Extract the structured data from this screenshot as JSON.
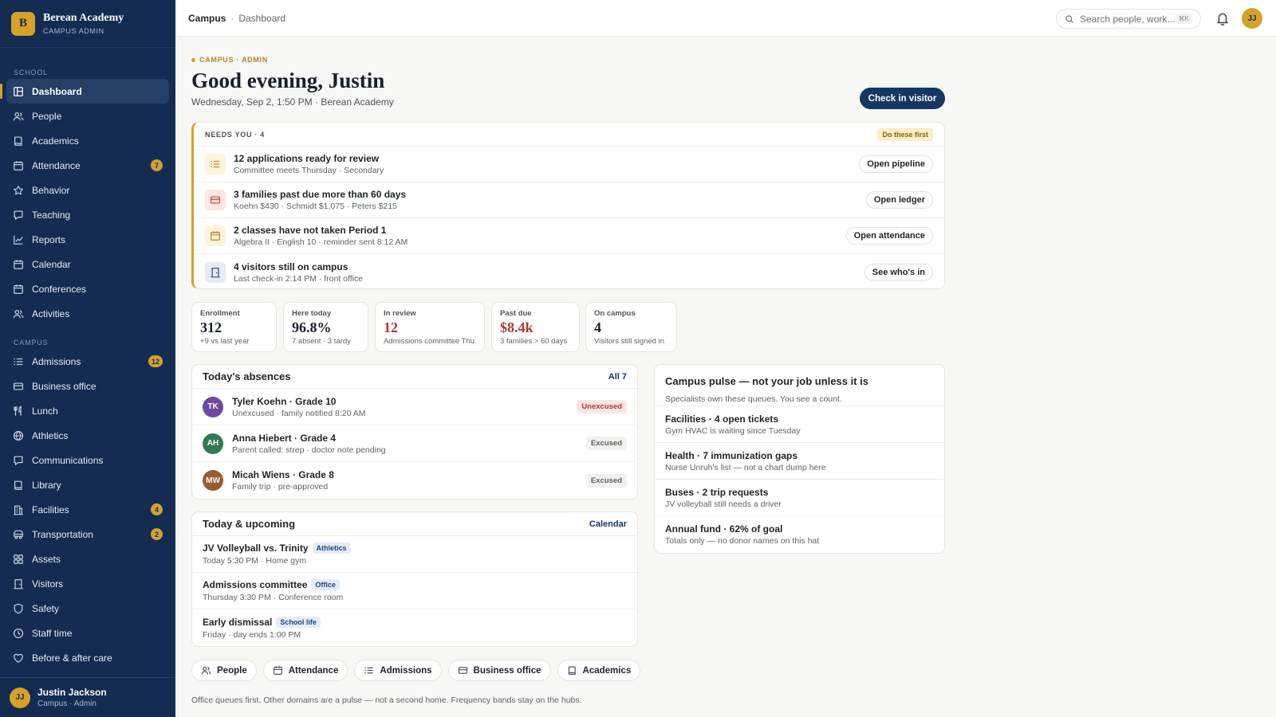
{
  "brand": {
    "initial": "B",
    "name": "Berean Academy",
    "role": "CAMPUS ADMIN"
  },
  "sidebar": {
    "school_label": "SCHOOL",
    "campus_label": "CAMPUS",
    "school_items": [
      {
        "label": "Dashboard",
        "icon": "dashboard-icon",
        "active": true
      },
      {
        "label": "People",
        "icon": "people-icon"
      },
      {
        "label": "Academics",
        "icon": "book-icon"
      },
      {
        "label": "Attendance",
        "icon": "calendar-icon",
        "badge": "7"
      },
      {
        "label": "Behavior",
        "icon": "star-icon"
      },
      {
        "label": "Teaching",
        "icon": "chat-icon"
      },
      {
        "label": "Reports",
        "icon": "chart-icon"
      },
      {
        "label": "Calendar",
        "icon": "calendar-icon"
      },
      {
        "label": "Conferences",
        "icon": "calendar-icon"
      },
      {
        "label": "Activities",
        "icon": "people-icon"
      }
    ],
    "campus_items": [
      {
        "label": "Admissions",
        "icon": "list-icon",
        "badge": "12"
      },
      {
        "label": "Business office",
        "icon": "card-icon"
      },
      {
        "label": "Lunch",
        "icon": "utensils-icon"
      },
      {
        "label": "Athletics",
        "icon": "ball-icon"
      },
      {
        "label": "Communications",
        "icon": "chat-icon"
      },
      {
        "label": "Library",
        "icon": "book-icon"
      },
      {
        "label": "Facilities",
        "icon": "building-icon",
        "badge": "4"
      },
      {
        "label": "Transportation",
        "icon": "bus-icon",
        "badge": "2"
      },
      {
        "label": "Assets",
        "icon": "grid-icon"
      },
      {
        "label": "Visitors",
        "icon": "door-icon"
      },
      {
        "label": "Safety",
        "icon": "shield-icon"
      },
      {
        "label": "Staff time",
        "icon": "clock-icon"
      },
      {
        "label": "Before & after care",
        "icon": "heart-icon"
      }
    ],
    "user": {
      "initials": "JJ",
      "name": "Justin Jackson",
      "role": "Campus · Admin"
    }
  },
  "topbar": {
    "crumb_root": "Campus",
    "crumb_sep": "·",
    "crumb_current": "Dashboard",
    "search_placeholder": "Search people, work...",
    "search_shortcut": "⌘K",
    "user_initials": "JJ"
  },
  "header": {
    "eyebrow": "CAMPUS · ADMIN",
    "greeting": "Good evening, Justin",
    "dateline": "Wednesday, Sep 2, 1:50 PM · Berean Academy",
    "primary_action": "Check in visitor"
  },
  "needs": {
    "title": "NEEDS YOU · 4",
    "pill": "Do these first",
    "items": [
      {
        "title": "12 applications ready for review",
        "sub": "Committee meets Thursday · Secondary",
        "action": "Open pipeline",
        "icon": "list-icon",
        "bg": "#fcf3dc",
        "fg": "#b4852a"
      },
      {
        "title": "3 families past due more than 60 days",
        "sub": "Koehn $430 · Schmidt $1,075 · Peters $215",
        "action": "Open ledger",
        "icon": "card-icon",
        "bg": "#fbe6e3",
        "fg": "#c0463a"
      },
      {
        "title": "2 classes have not taken Period 1",
        "sub": "Algebra II · English 10 · reminder sent 8:12 AM",
        "action": "Open attendance",
        "icon": "calendar-icon",
        "bg": "#fcf3dc",
        "fg": "#b4852a"
      },
      {
        "title": "4 visitors still on campus",
        "sub": "Last check-in 2:14 PM · front office",
        "action": "See who's in",
        "icon": "door-icon",
        "bg": "#e6ecf5",
        "fg": "#2c4b78"
      }
    ]
  },
  "stats": [
    {
      "label": "Enrollment",
      "value": "312",
      "sub": "+9 vs last year",
      "color": "#1a1f2b"
    },
    {
      "label": "Here today",
      "value": "96.8%",
      "sub": "7 absent · 3 tardy",
      "color": "#1a1f2b"
    },
    {
      "label": "In review",
      "value": "12",
      "sub": "Admissions committee Thu",
      "color": "#b3362b"
    },
    {
      "label": "Past due",
      "value": "$8.4k",
      "sub": "3 families > 60 days",
      "color": "#b3362b"
    },
    {
      "label": "On campus",
      "value": "4",
      "sub": "Visitors still signed in",
      "color": "#1a1f2b"
    }
  ],
  "absences": {
    "title": "Today's absences",
    "link": "All 7",
    "items": [
      {
        "initials": "TK",
        "color": "#6c4a9e",
        "name": "Tyler Koehn · Grade 10",
        "sub": "Unexcused · family notified 8:20 AM",
        "status": "Unexcused",
        "kind": "unexcused"
      },
      {
        "initials": "AH",
        "color": "#2f7a55",
        "name": "Anna Hiebert · Grade 4",
        "sub": "Parent called: strep · doctor note pending",
        "status": "Excused",
        "kind": "excused"
      },
      {
        "initials": "MW",
        "color": "#9a5b2e",
        "name": "Micah Wiens · Grade 8",
        "sub": "Family trip · pre-approved",
        "status": "Excused",
        "kind": "excused"
      }
    ]
  },
  "upcoming": {
    "title": "Today & upcoming",
    "link": "Calendar",
    "items": [
      {
        "title": "JV Volleyball vs. Trinity",
        "tag": "Athletics",
        "sub": "Today 5:30 PM · Home gym"
      },
      {
        "title": "Admissions committee",
        "tag": "Office",
        "sub": "Thursday 3:30 PM · Conference room"
      },
      {
        "title": "Early dismissal",
        "tag": "School life",
        "sub": "Friday · day ends 1:00 PM"
      }
    ]
  },
  "pulse": {
    "title": "Campus pulse — not your job unless it is",
    "desc": "Specialists own these queues. You see a count.",
    "items": [
      {
        "title": "Facilities · 4 open tickets",
        "sub": "Gym HVAC is waiting since Tuesday"
      },
      {
        "title": "Health · 7 immunization gaps",
        "sub": "Nurse Unruh's list — not a chart dump here"
      },
      {
        "title": "Buses · 2 trip requests",
        "sub": "JV volleyball still needs a driver"
      },
      {
        "title": "Annual fund · 62% of goal",
        "sub": "Totals only — no donor names on this hat"
      }
    ]
  },
  "quick_links": [
    {
      "label": "People",
      "icon": "people-icon"
    },
    {
      "label": "Attendance",
      "icon": "calendar-icon"
    },
    {
      "label": "Admissions",
      "icon": "list-icon"
    },
    {
      "label": "Business office",
      "icon": "card-icon"
    },
    {
      "label": "Academics",
      "icon": "book-icon"
    }
  ],
  "footnote": "Office queues first. Other domains are a pulse — not a second home. Frequency bands stay on the hubs.",
  "colors": {
    "sidebar": "#142c52",
    "accent": "#d4a22a",
    "primary": "#153764",
    "danger": "#b3362b"
  }
}
